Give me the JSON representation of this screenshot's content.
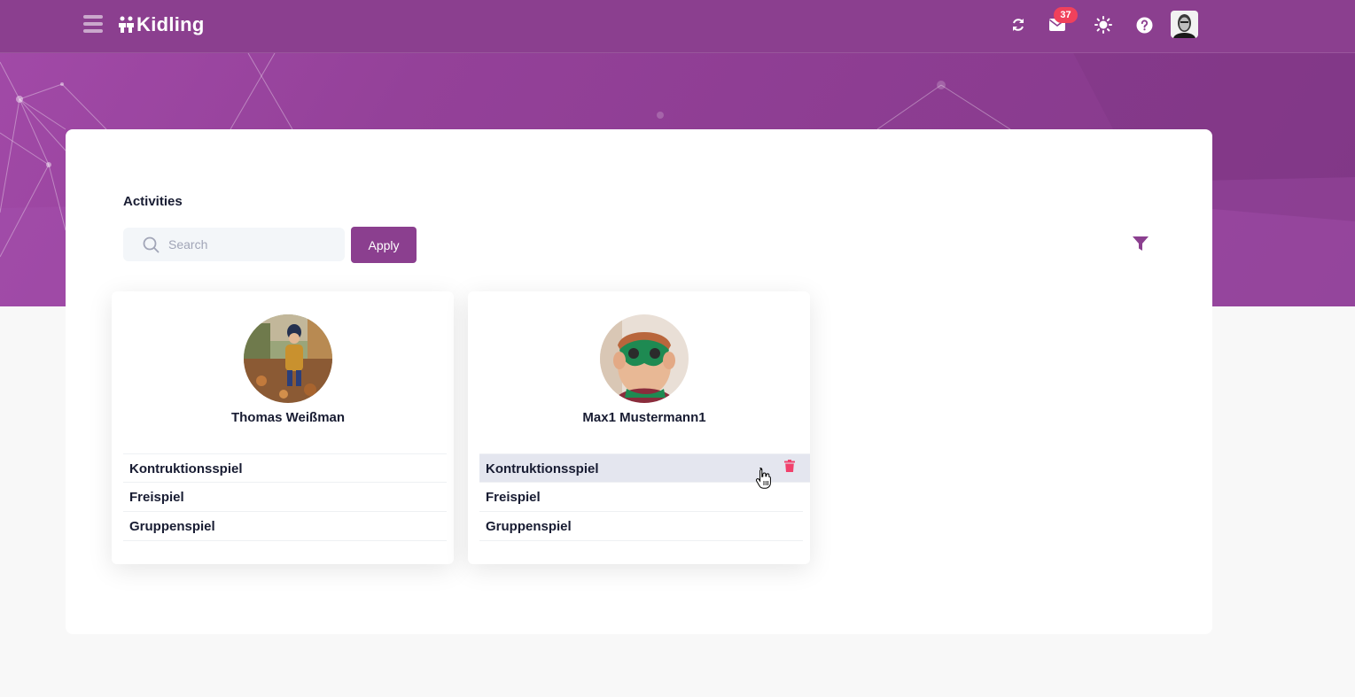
{
  "app": {
    "name": "Kidling"
  },
  "header": {
    "message_count": "37",
    "icons": [
      "sync-icon",
      "mail-icon",
      "sun-icon",
      "help-icon",
      "user-avatar"
    ]
  },
  "page": {
    "title": "Activities",
    "search": {
      "placeholder": "Search",
      "value": ""
    },
    "apply_label": "Apply"
  },
  "children": [
    {
      "name": "Thomas Weißman",
      "activities": [
        "Kontruktionsspiel",
        "Freispiel",
        "Gruppenspiel"
      ]
    },
    {
      "name": "Max1 Mustermann1",
      "activities": [
        "Kontruktionsspiel",
        "Freispiel",
        "Gruppenspiel"
      ]
    }
  ],
  "colors": {
    "brand": "#8b3f8f",
    "badge": "#f0415b",
    "delete": "#f1416c"
  }
}
